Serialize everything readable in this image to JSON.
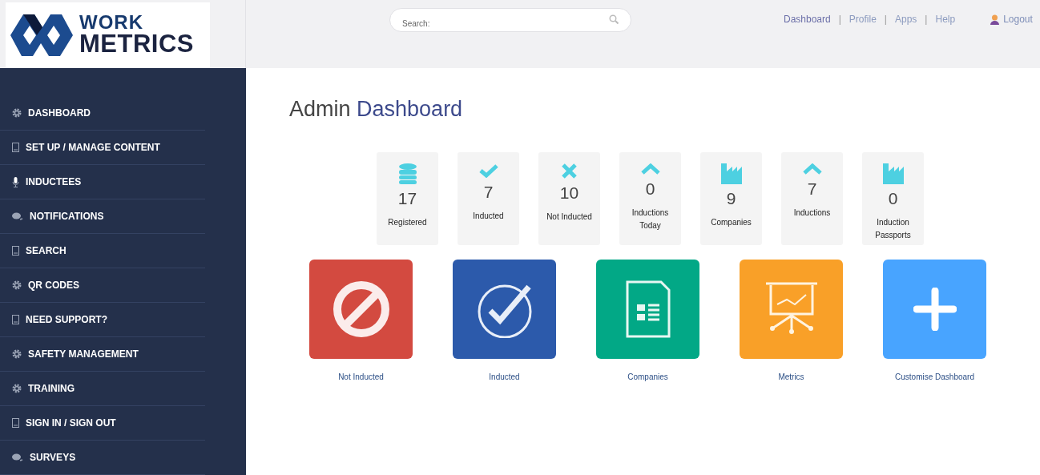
{
  "logo": {
    "line_1": "WORK",
    "line_2": "METRICS"
  },
  "search": {
    "placeholder": "Search:"
  },
  "top_nav": {
    "links": [
      {
        "label": "Dashboard"
      },
      {
        "label": "Profile"
      },
      {
        "label": "Apps"
      },
      {
        "label": "Help"
      }
    ],
    "separator": "|",
    "logout": "Logout"
  },
  "sidebar": {
    "items": [
      {
        "label": "DASHBOARD",
        "kind": "gear"
      },
      {
        "label": "SET UP / MANAGE CONTENT",
        "kind": "doc"
      },
      {
        "label": "INDUCTEES",
        "kind": "mic"
      },
      {
        "label": "NOTIFICATIONS",
        "kind": "chat"
      },
      {
        "label": "SEARCH",
        "kind": "doc"
      },
      {
        "label": "QR CODES",
        "kind": "gear"
      },
      {
        "label": "NEED SUPPORT?",
        "kind": "doc"
      },
      {
        "label": "SAFETY MANAGEMENT",
        "kind": "gear"
      },
      {
        "label": "TRAINING",
        "kind": "gear"
      },
      {
        "label": "SIGN IN / SIGN OUT",
        "kind": "doc"
      },
      {
        "label": "SURVEYS",
        "kind": "chat"
      }
    ]
  },
  "title": {
    "prefix": "Admin",
    "emphasis": "Dashboard"
  },
  "stats": [
    {
      "kind": "database",
      "value": "17",
      "label": "Registered"
    },
    {
      "kind": "check",
      "value": "7",
      "label": "Inducted"
    },
    {
      "kind": "cross",
      "value": "10",
      "label": "Not Inducted"
    },
    {
      "kind": "chevron",
      "value": "0",
      "label": "Inductions Today"
    },
    {
      "kind": "factory",
      "value": "9",
      "label": "Companies"
    },
    {
      "kind": "chevron",
      "value": "7",
      "label": "Inductions"
    },
    {
      "kind": "factory",
      "value": "0",
      "label": "Induction Passports"
    }
  ],
  "tiles": [
    {
      "kind": "ban",
      "label": "Not Inducted",
      "color": "#d34a40"
    },
    {
      "kind": "check-circle",
      "label": "Inducted",
      "color": "#2c5aab"
    },
    {
      "kind": "sheet",
      "label": "Companies",
      "color": "#02a886"
    },
    {
      "kind": "presentation",
      "label": "Metrics",
      "color": "#f9a028"
    },
    {
      "kind": "plus",
      "label": "Customise Dashboard",
      "color": "#48a4ff"
    }
  ]
}
